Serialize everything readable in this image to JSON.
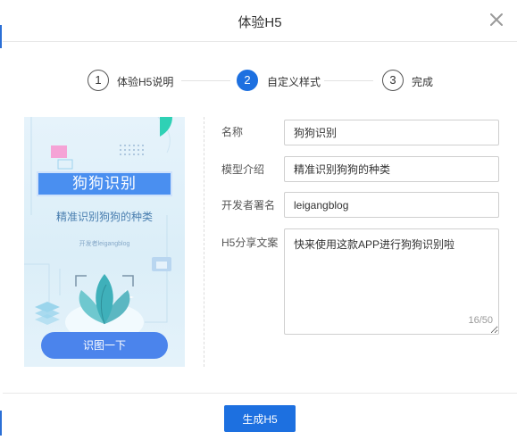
{
  "dialog": {
    "title": "体验H5"
  },
  "steps": [
    {
      "number": "1",
      "label": "体验H5说明",
      "state": "done"
    },
    {
      "number": "2",
      "label": "自定义样式",
      "state": "active"
    },
    {
      "number": "3",
      "label": "完成",
      "state": "pending"
    }
  ],
  "preview": {
    "title": "狗狗识别",
    "description": "精准识别狗狗的种类",
    "author": "开发者leigangblog",
    "button_label": "识图一下"
  },
  "form": {
    "name_label": "名称",
    "name_value": "狗狗识别",
    "model_label": "模型介绍",
    "model_value": "精准识别狗狗的种类",
    "developer_label": "开发者署名",
    "developer_value": "leigangblog",
    "share_label": "H5分享文案",
    "share_value": "快来使用这款APP进行狗狗识别啦",
    "counter": "16/50"
  },
  "footer": {
    "submit_label": "生成H5"
  },
  "colors": {
    "primary": "#1d70e0",
    "preview_button": "#4b84ec",
    "preview_title_bg": "#4a8ff0",
    "accent_teal": "#2fd1b5",
    "accent_pink": "#f5a3d6"
  },
  "icons": {
    "close": "close-icon",
    "plant": "plant-illustration-icon"
  }
}
